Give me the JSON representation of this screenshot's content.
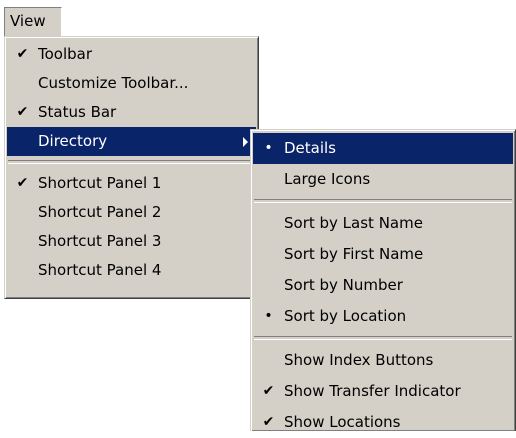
{
  "menubar": {
    "view_label": "View"
  },
  "main_menu": {
    "group1": [
      {
        "label": "Toolbar",
        "mark": "✔"
      },
      {
        "label": "Customize Toolbar...",
        "mark": ""
      },
      {
        "label": "Status Bar",
        "mark": "✔"
      },
      {
        "label": "Directory",
        "mark": ""
      }
    ],
    "group2": [
      {
        "label": "Shortcut Panel 1",
        "mark": "✔"
      },
      {
        "label": "Shortcut Panel 2",
        "mark": ""
      },
      {
        "label": "Shortcut Panel 3",
        "mark": ""
      },
      {
        "label": "Shortcut Panel 4",
        "mark": ""
      }
    ]
  },
  "submenu": {
    "group1": [
      {
        "label": "Details",
        "mark": "•"
      },
      {
        "label": "Large Icons",
        "mark": ""
      }
    ],
    "group2": [
      {
        "label": "Sort by Last Name",
        "mark": ""
      },
      {
        "label": "Sort by First Name",
        "mark": ""
      },
      {
        "label": "Sort by Number",
        "mark": ""
      },
      {
        "label": "Sort by Location",
        "mark": "•"
      }
    ],
    "group3": [
      {
        "label": "Show Index Buttons",
        "mark": ""
      },
      {
        "label": "Show Transfer Indicator",
        "mark": "✔"
      },
      {
        "label": "Show Locations",
        "mark": "✔"
      }
    ]
  },
  "colors": {
    "menu_bg": "#d4d0c8",
    "highlight_bg": "#0a246a",
    "highlight_text": "#ffffff"
  }
}
